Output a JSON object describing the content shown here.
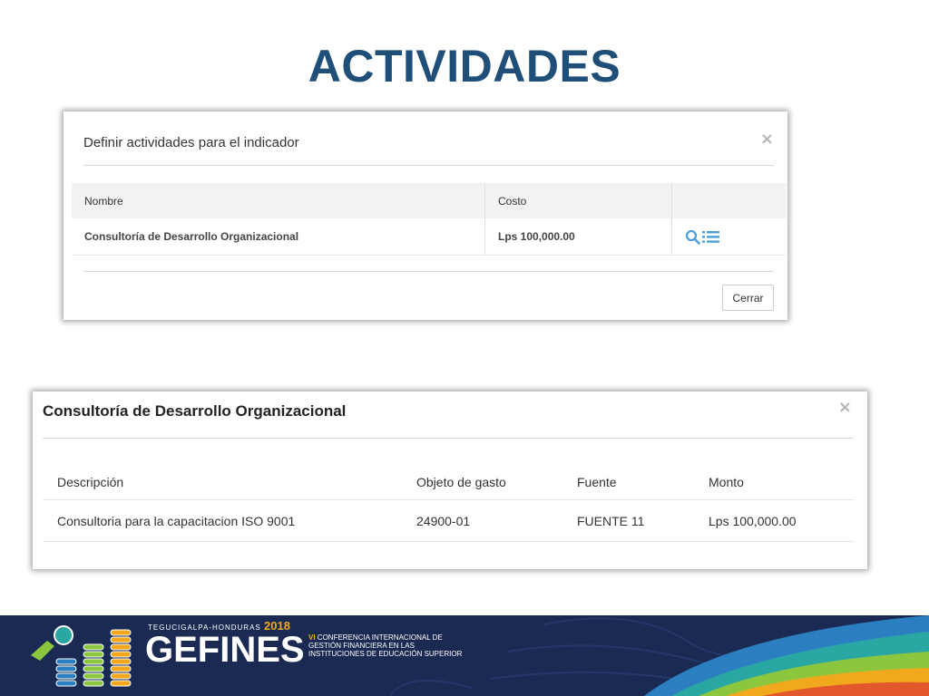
{
  "slide": {
    "title": "ACTIVIDADES"
  },
  "modal1": {
    "title": "Definir actividades para el indicador",
    "close_symbol": "×",
    "columns": [
      "Nombre",
      "Costo",
      ""
    ],
    "rows": [
      {
        "nombre": "Consultoría de Desarrollo Organizacional",
        "costo": "Lps 100,000.00",
        "actions": [
          "search-icon",
          "list-icon"
        ]
      }
    ],
    "close_button": "Cerrar"
  },
  "modal2": {
    "title": "Consultoría de Desarrollo Organizacional",
    "close_symbol": "×",
    "columns": [
      "Descripción",
      "Objeto de gasto",
      "Fuente",
      "Monto"
    ],
    "rows": [
      {
        "descripcion": "Consultoria para la capacitacion ISO 9001",
        "objeto": "24900-01",
        "fuente": "FUENTE 11",
        "monto": "Lps 100,000.00"
      }
    ]
  },
  "footer": {
    "location": "TEGUCIGALPA-HONDURAS",
    "year": "2018",
    "brand": "GEFINES",
    "tagline_prefix": "VI",
    "tagline": "CONFERENCIA INTERNACIONAL DE GESTIÓN FINANCIERA EN LAS INSTITUCIONES DE EDUCACIÓN SUPERIOR"
  },
  "colors": {
    "title": "#1f4e79",
    "icon_accent": "#4a9fd8",
    "footer_bg": "#1b2a52",
    "footer_accent": "#f2a81d"
  }
}
